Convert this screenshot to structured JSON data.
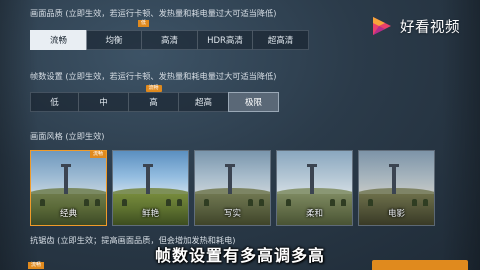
{
  "quality": {
    "label": "画面品质 (立即生效，若运行卡顿、发热量和耗电量过大可适当降低)",
    "top_tag": "低",
    "options": [
      {
        "label": "流畅",
        "selected": true,
        "tag": ""
      },
      {
        "label": "均衡",
        "selected": false,
        "tag": ""
      },
      {
        "label": "高清",
        "selected": false,
        "tag": ""
      },
      {
        "label": "HDR高清",
        "selected": false,
        "tag": ""
      },
      {
        "label": "超高清",
        "selected": false,
        "tag": ""
      }
    ]
  },
  "framerate": {
    "label": "帧数设置 (立即生效，若运行卡顿、发热量和耗电量过大可适当降低)",
    "options": [
      {
        "label": "低",
        "selected": false,
        "tag": ""
      },
      {
        "label": "中",
        "selected": false,
        "tag": ""
      },
      {
        "label": "高",
        "selected": false,
        "tag": "流畅"
      },
      {
        "label": "超高",
        "selected": false,
        "tag": ""
      },
      {
        "label": "极限",
        "selected": true,
        "tag": ""
      }
    ]
  },
  "style": {
    "label": "画面风格 (立即生效)",
    "options": [
      {
        "label": "经典",
        "selected": true,
        "tag": "流畅"
      },
      {
        "label": "鲜艳",
        "selected": false,
        "tag": ""
      },
      {
        "label": "写实",
        "selected": false,
        "tag": ""
      },
      {
        "label": "柔和",
        "selected": false,
        "tag": ""
      },
      {
        "label": "电影",
        "selected": false,
        "tag": ""
      }
    ]
  },
  "antialias": {
    "label": "抗锯齿 (立即生效；提高画面品质，但会增加发热和耗电)",
    "tag": "流畅"
  },
  "watermark": {
    "text": "好看视频"
  },
  "subtitle": "帧数设置有多高调多高",
  "colors": {
    "accent": "#e08a1e",
    "selected_bg": "#e9eef3"
  }
}
